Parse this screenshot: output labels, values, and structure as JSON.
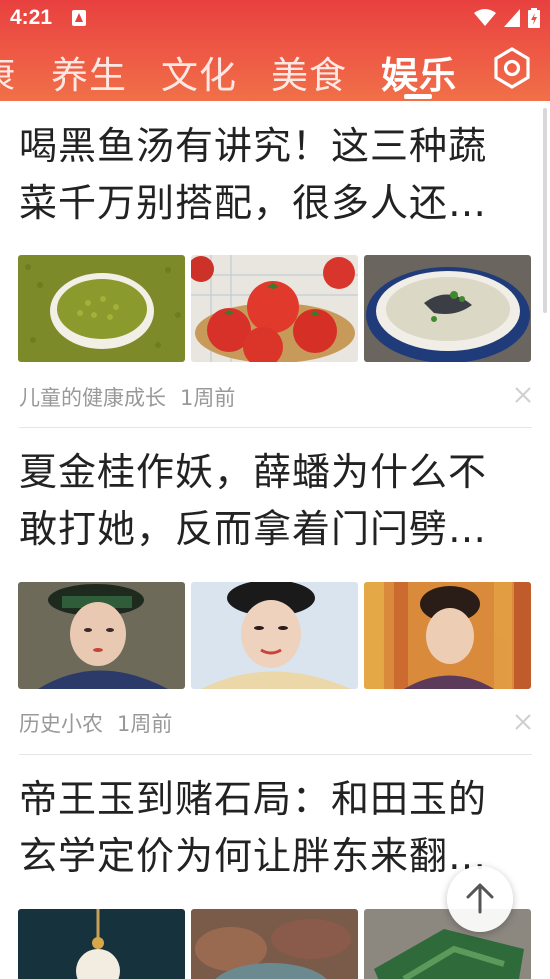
{
  "status_bar": {
    "time": "4:21",
    "icons": [
      "notification-a-icon",
      "wifi-icon",
      "signal-icon",
      "battery-icon"
    ]
  },
  "tabs": {
    "items": [
      {
        "label": "康",
        "active": false
      },
      {
        "label": "养生",
        "active": false
      },
      {
        "label": "文化",
        "active": false
      },
      {
        "label": "美食",
        "active": false
      },
      {
        "label": "娱乐",
        "active": true
      }
    ],
    "settings_icon": "hexagon-settings-icon"
  },
  "colors": {
    "header_top": "#e8403f",
    "header_bottom": "#f07048",
    "title_text": "#222222",
    "meta_text": "#999999"
  },
  "articles": [
    {
      "title_line1": "喝黑鱼汤有讲究！这三种蔬",
      "title_line2": "菜千万别搭配，很多人还…",
      "source": "儿童的健康成长",
      "time": "1周前",
      "images": [
        "mung-beans-bowl",
        "tomatoes-basket",
        "fish-soup-bowl"
      ]
    },
    {
      "title_line1": "夏金桂作妖，薛蟠为什么不",
      "title_line2": "敢打她，反而拿着门闩劈…",
      "source": "历史小农",
      "time": "1周前",
      "images": [
        "actress-portrait-headdress",
        "actress-portrait-smiling",
        "actress-portrait-colorful"
      ]
    },
    {
      "title_line1": "帝王玉到赌石局：和田玉的",
      "title_line2": "玄学定价为何让胖东来翻…",
      "source": "",
      "time": "",
      "images": [
        "jade-pendant",
        "rough-stone-pile",
        "green-jade-stone"
      ]
    }
  ],
  "back_to_top_icon": "arrow-up-icon"
}
